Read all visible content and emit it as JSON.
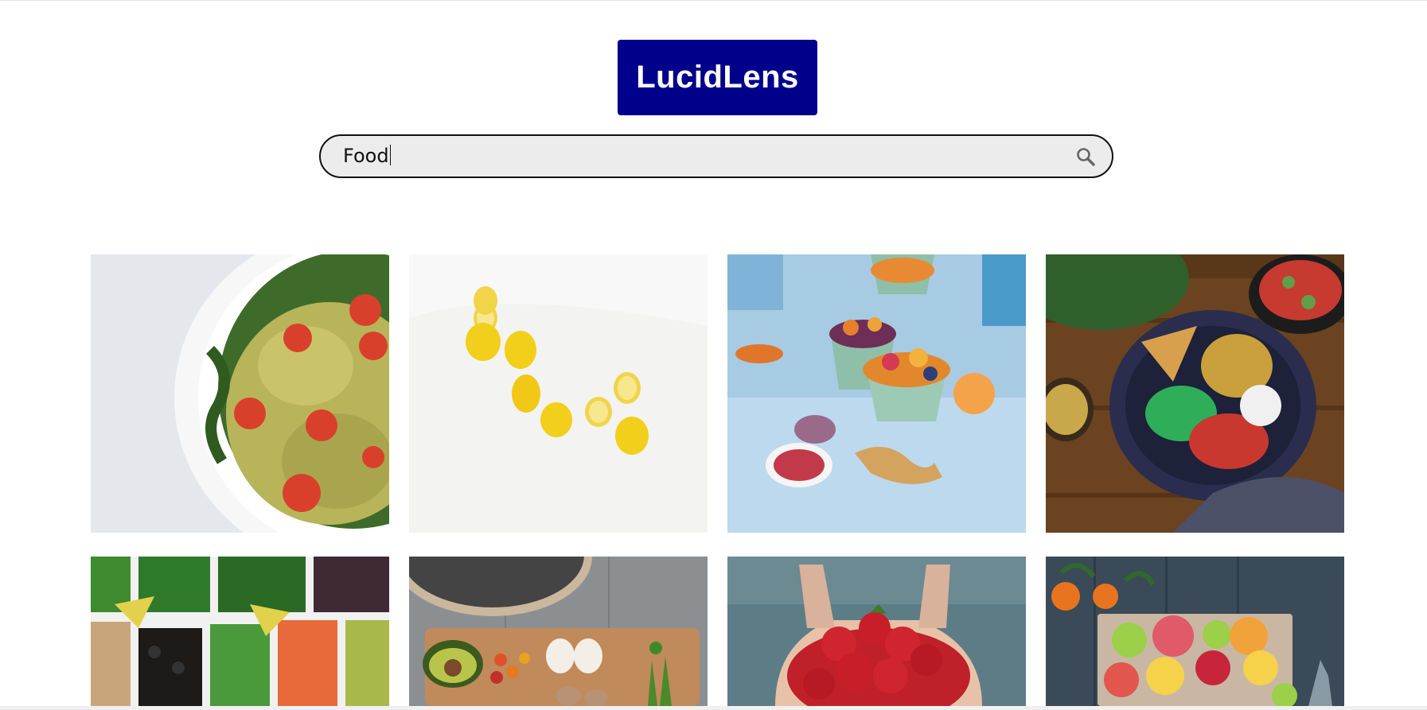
{
  "header": {
    "logo_text": "LucidLens",
    "logo_color": "#00008b"
  },
  "search": {
    "value": "Food",
    "icon": "search-icon"
  },
  "results": {
    "images": [
      {
        "subject": "pasta-salad-image"
      },
      {
        "subject": "lemons-image"
      },
      {
        "subject": "smoothie-bowls-image"
      },
      {
        "subject": "vegetable-bowl-image"
      },
      {
        "subject": "salad-bar-image"
      },
      {
        "subject": "cutting-board-ingredients-image"
      },
      {
        "subject": "strawberries-in-hands-image"
      },
      {
        "subject": "sliced-citrus-image"
      }
    ]
  }
}
